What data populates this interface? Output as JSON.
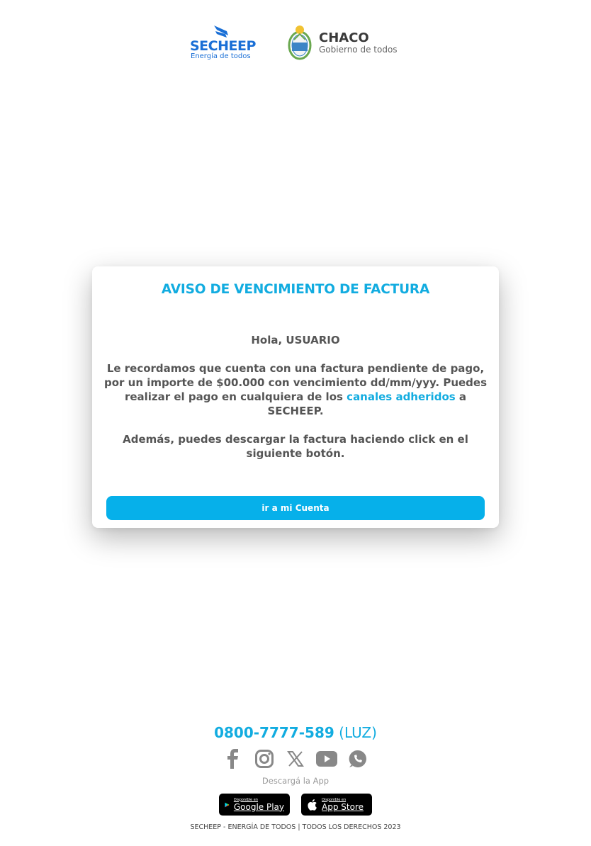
{
  "header": {
    "secheep_logo": {
      "name": "SECHEEP",
      "tagline": "Energía de todos"
    },
    "chaco_logo": {
      "name": "CHACO",
      "tagline": "Gobierno de todos"
    }
  },
  "card": {
    "title": "AVISO DE VENCIMIENTO DE FACTURA",
    "greeting": "Hola, USUARIO",
    "reminder_before_link": "Le recordamos que cuenta con una factura pendiente de pago, por un importe de $00.000 con vencimiento dd/mm/yyy. Puedes realizar el pago en cualquiera de los ",
    "reminder_link": "canales adheridos",
    "reminder_after_link": " a SECHEEP.",
    "download_text": "Además, puedes descargar la factura haciendo click en el siguiente botón.",
    "button_label": "ir a mi Cuenta"
  },
  "footer": {
    "phone_number": "0800-7777-589",
    "phone_suffix": "(LUZ)",
    "social_icons": [
      "facebook-icon",
      "instagram-icon",
      "x-icon",
      "youtube-icon",
      "whatsapp-icon"
    ],
    "download_label": "Descargá la App",
    "google_play": {
      "small": "Disponible en",
      "big": "Google Play"
    },
    "app_store": {
      "small": "Disponible en",
      "big": "App Store"
    },
    "copyright": "SECHEEP - ENERGÍA DE TODOS | TODOS LOS DERECHOS 2023"
  },
  "colors": {
    "accent": "#12ace0",
    "button": "#06b0ea",
    "body_text": "#555555",
    "icon_gray": "#888888",
    "secheep_blue": "#1a6fd6"
  }
}
